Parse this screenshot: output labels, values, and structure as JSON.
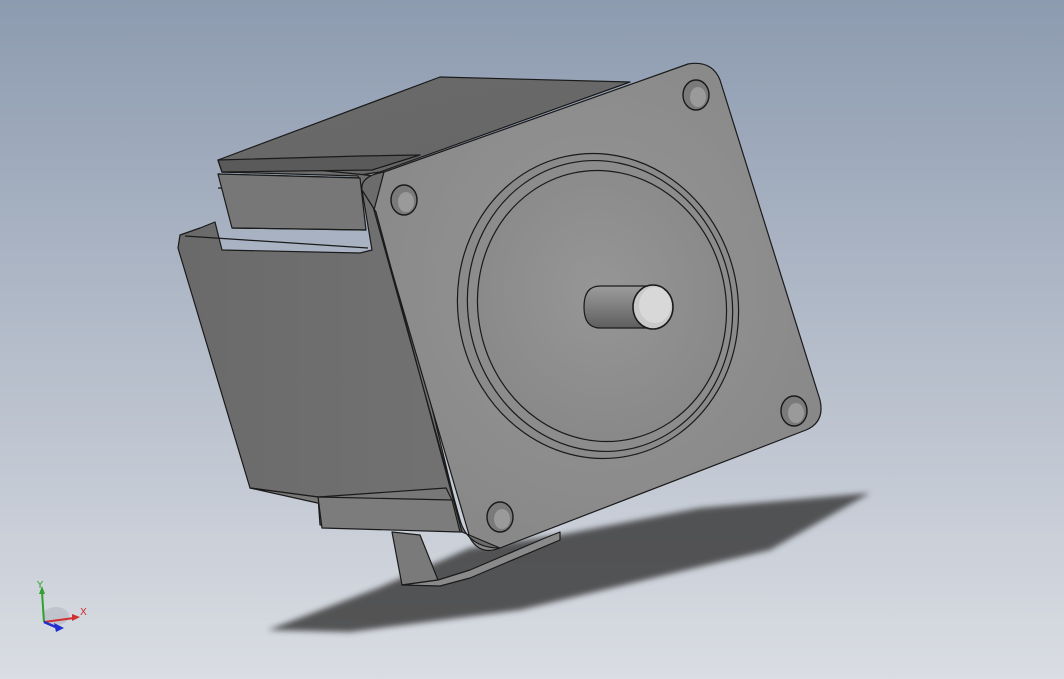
{
  "viewport": {
    "background_top": "#8D9BB0",
    "background_bottom": "#DADDE3",
    "model": {
      "body_color": "#6E6E6E",
      "face_color": "#8E8E8E",
      "edge_color": "#1A1A1A",
      "shaft_color": "#D0D0D0",
      "shadow_color": "#3C3C3C"
    }
  },
  "triad": {
    "x_label": "X",
    "y_label": "Y",
    "x_color": "#D03030",
    "y_color": "#30A030",
    "z_color": "#2030D0"
  }
}
